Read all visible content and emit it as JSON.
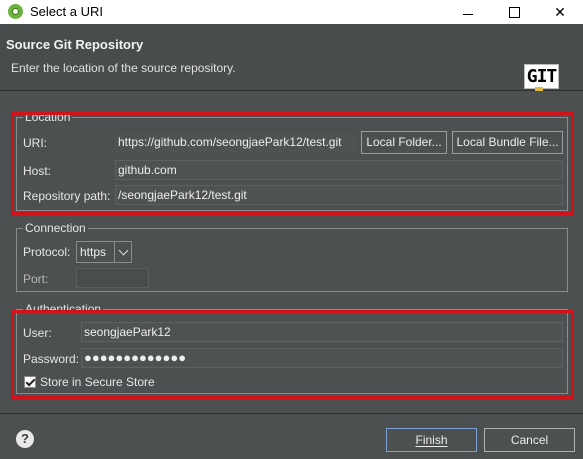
{
  "window": {
    "title": "Select a URI",
    "minimize": "—",
    "close": "✕"
  },
  "header": {
    "title": "Source Git Repository",
    "subtitle": "Enter the location of the source repository.",
    "logo_text": "GIT"
  },
  "location": {
    "legend": "Location",
    "uri_label": "URI:",
    "uri_value": "https://github.com/seongjaePark12/test.git",
    "local_folder_label": "Local Folder...",
    "local_bundle_label": "Local Bundle File...",
    "host_label": "Host:",
    "host_value": "github.com",
    "repo_path_label": "Repository path:",
    "repo_path_value": "/seongjaePark12/test.git"
  },
  "connection": {
    "legend": "Connection",
    "protocol_label": "Protocol:",
    "protocol_value": "https",
    "port_label": "Port:",
    "port_value": ""
  },
  "authentication": {
    "legend": "Authentication",
    "user_label": "User:",
    "user_value": "seongjaePark12",
    "password_label": "Password:",
    "password_value": "●●●●●●●●●●●●●",
    "store_label": "Store in Secure Store",
    "store_checked": true
  },
  "footer": {
    "help": "?",
    "finish_label": "Finish",
    "cancel_label": "Cancel"
  },
  "colors": {
    "highlight": "#d4111b",
    "background": "#4d5051",
    "primary_border": "#7aa2d6"
  }
}
